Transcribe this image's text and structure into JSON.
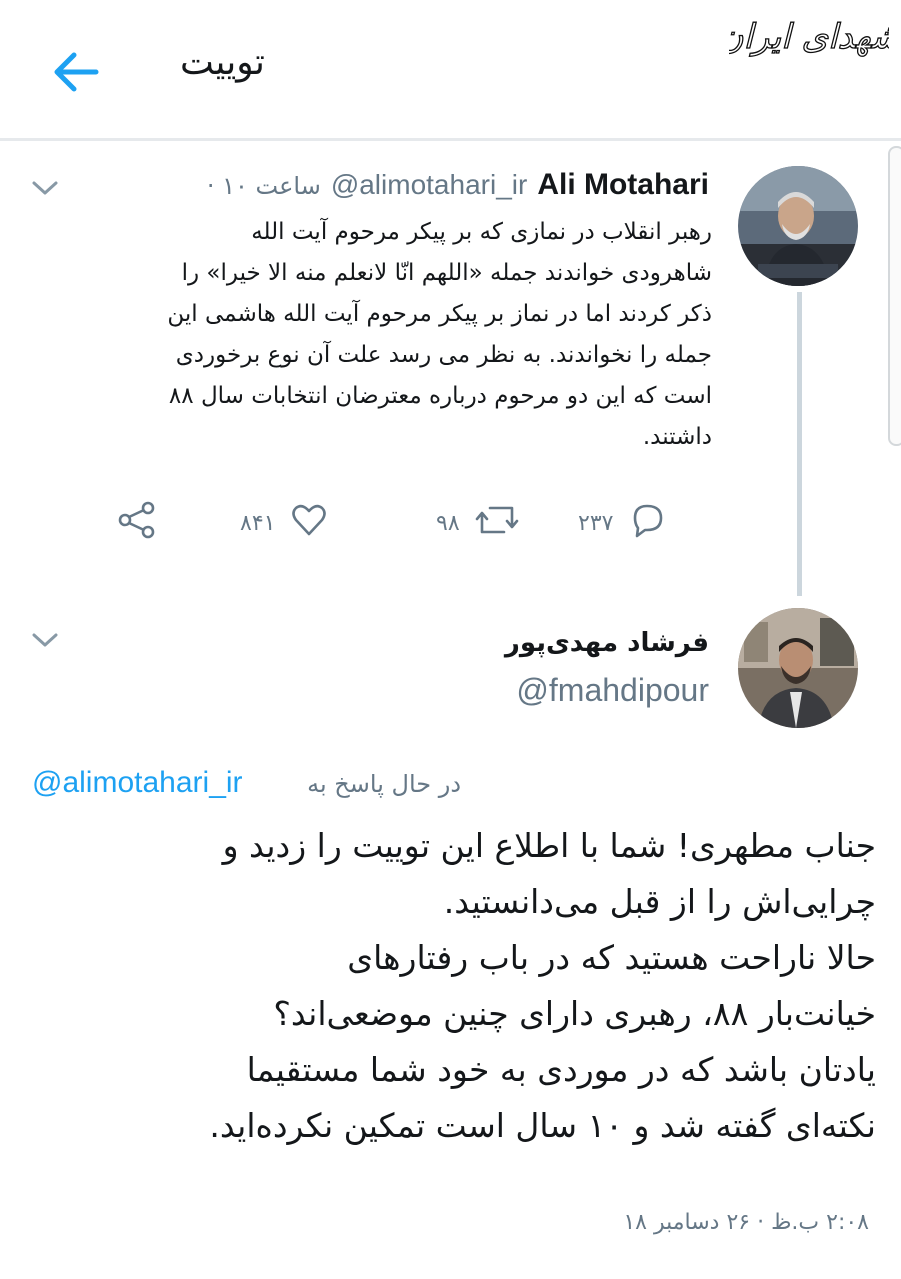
{
  "header": {
    "title": "توییت",
    "back_icon": "back-arrow-icon",
    "accent": "#1da1f2",
    "watermark_text": "شهدای ایران"
  },
  "tweet": {
    "author_name": "Ali Motahari",
    "author_handle": "@alimotahari_ir",
    "time": "· ۱۰ ساعت",
    "lines": [
      "رهبر انقلاب در نمازی که بر پیکر مرحوم آیت الله",
      "شاهرودی خواندند جمله «اللهم انّا لانعلم منه الا خیرا» را",
      "ذکر کردند اما در نماز بر پیکر مرحوم آیت الله هاشمی این",
      "جمله را نخواندند. به نظر می رسد علت آن نوع برخوردی",
      "است که این دو مرحوم درباره معترضان انتخابات سال ۸۸",
      "داشتند."
    ],
    "actions": {
      "replies": "۲۳۷",
      "retweets": "۹۸",
      "likes": "۸۴۱"
    }
  },
  "reply": {
    "author_name": "فرشاد مهدی‌پور",
    "author_handle": "@fmahdipour",
    "replying_to_label": "در حال پاسخ به",
    "replying_to_handle": "@alimotahari_ir",
    "lines": [
      "جناب مطهری! شما با اطلاع این توییت را زدید و",
      "چرایی‌اش را از قبل می‌دانستید.",
      "حالا ناراحت هستید که در باب رفتارهای",
      "خیانت‌بار ۸۸، رهبری دارای چنین موضعی‌اند؟",
      "یادتان باشد که در موردی به خود شما مستقیما",
      "نکته‌ای گفته شد و ۱۰ سال است تمکین نکرده‌اید."
    ],
    "timestamp": "۲:۰۸ ب.ظ · ۲۶ دسامبر ۱۸"
  }
}
